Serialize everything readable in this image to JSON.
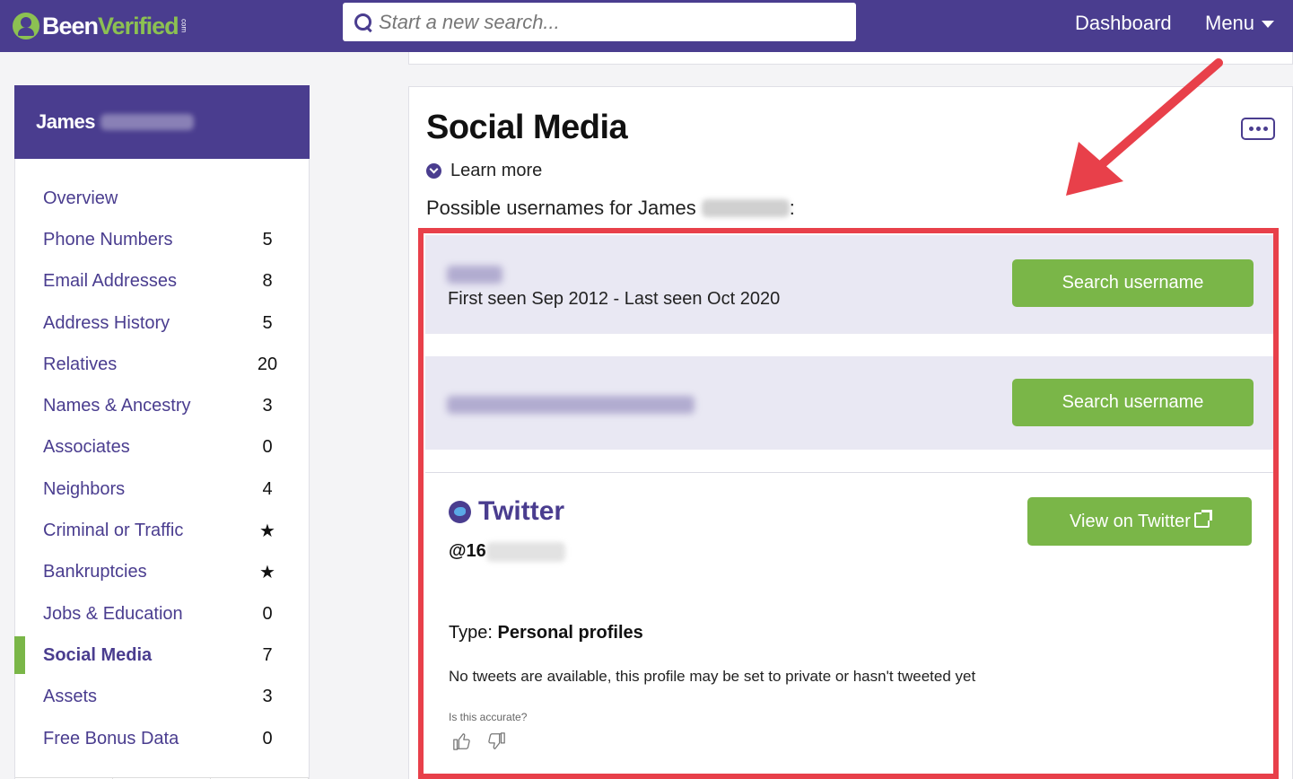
{
  "header": {
    "logo_text_a": "Been",
    "logo_text_b": "Verified",
    "logo_com": "com",
    "search_placeholder": "Start a new search...",
    "dashboard_label": "Dashboard",
    "menu_label": "Menu"
  },
  "sidebar": {
    "person_first_name": "James",
    "items": [
      {
        "label": "Overview",
        "count": ""
      },
      {
        "label": "Phone Numbers",
        "count": "5"
      },
      {
        "label": "Email Addresses",
        "count": "8"
      },
      {
        "label": "Address History",
        "count": "5"
      },
      {
        "label": "Relatives",
        "count": "20"
      },
      {
        "label": "Names & Ancestry",
        "count": "3"
      },
      {
        "label": "Associates",
        "count": "0"
      },
      {
        "label": "Neighbors",
        "count": "4"
      },
      {
        "label": "Criminal or Traffic",
        "count": "★"
      },
      {
        "label": "Bankruptcies",
        "count": "★"
      },
      {
        "label": "Jobs & Education",
        "count": "0"
      },
      {
        "label": "Social Media",
        "count": "7"
      },
      {
        "label": "Assets",
        "count": "3"
      },
      {
        "label": "Free Bonus Data",
        "count": "0"
      }
    ],
    "active_item": "Social Media"
  },
  "main": {
    "title": "Social Media",
    "learn_more": "Learn more",
    "possible_usernames": "Possible usernames for James",
    "possible_suffix": ":",
    "usernames": [
      {
        "seen": "First seen Sep 2012 - Last seen Oct 2020",
        "button": "Search username"
      },
      {
        "seen": "",
        "button": "Search username"
      }
    ],
    "twitter": {
      "title": "Twitter",
      "handle_prefix": "@16",
      "button": "View on Twitter",
      "type_label": "Type:",
      "type_value": "Personal profiles",
      "note": "No tweets are available, this profile may be set to private or hasn't tweeted yet",
      "accurate_prompt": "Is this accurate?"
    }
  },
  "colors": {
    "brand_purple": "#4a3d8f",
    "brand_green": "#7ab648",
    "highlight_red": "#e8404a"
  },
  "icons": [
    "search-icon",
    "caret-down-icon",
    "chevron-down-circle-icon",
    "more-icon",
    "twitter-icon",
    "external-link-icon",
    "thumbs-up-icon",
    "thumbs-down-icon",
    "star-icon"
  ]
}
